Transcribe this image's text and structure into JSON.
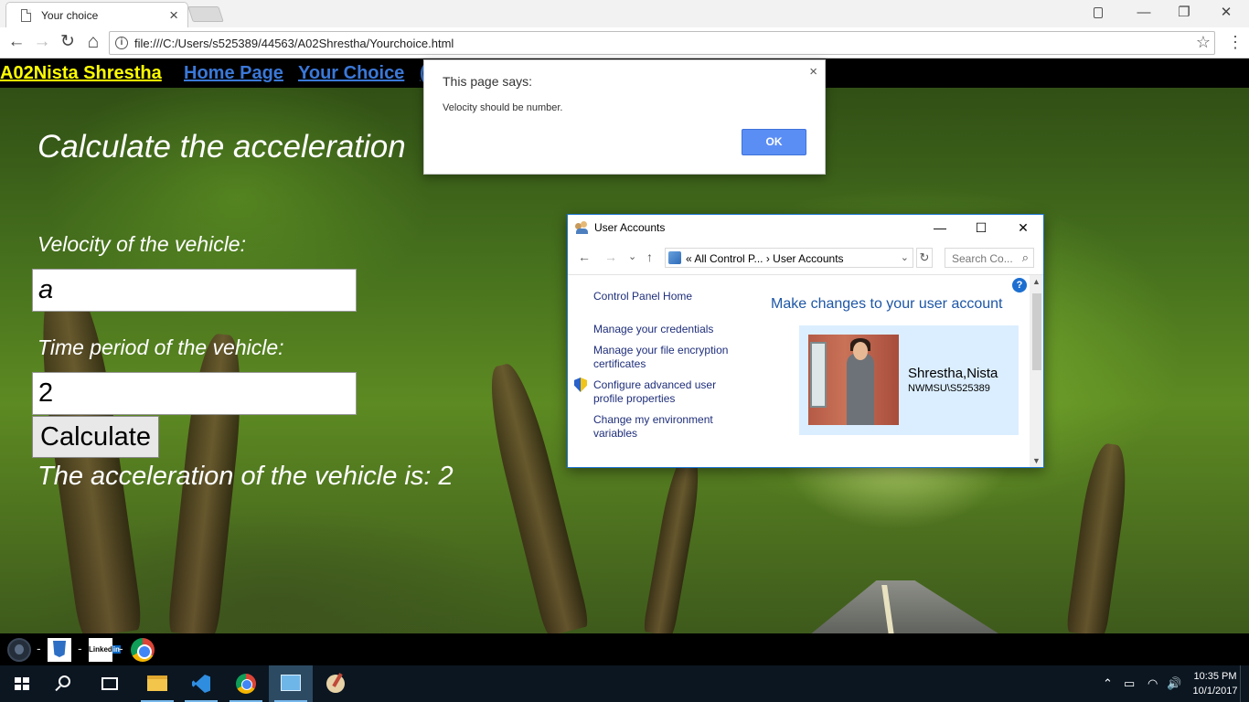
{
  "browser": {
    "tab_title": "Your choice",
    "tab_close": "×",
    "url": "file:///C:/Users/s525389/44563/A02Shrestha/Yourchoice.html",
    "back": "←",
    "forward": "→",
    "reload": "↻",
    "home": "⌂",
    "info": "i",
    "star": "☆",
    "menu": "⋮",
    "win_minimize": "—",
    "win_restore": "❐",
    "win_close": "✕"
  },
  "site_nav": {
    "brand": "A02Nista  Shrestha ",
    "home": "Home Page ",
    "your_choice": "Your Choice ",
    "partial": "("
  },
  "form": {
    "heading": "Calculate the acceleration",
    "velocity_label": "Velocity of the vehicle:",
    "velocity_value": "a",
    "time_label": "Time period of the vehicle:",
    "time_value": "2",
    "calculate_label": "Calculate",
    "result": "The acceleration of the vehicle is: 2"
  },
  "alert": {
    "title": "This page says:",
    "message": "Velocity should be number.",
    "ok_label": "OK",
    "close": "×"
  },
  "user_accounts": {
    "title": "User Accounts",
    "minimize": "—",
    "maximize": "☐",
    "close": "✕",
    "back": "←",
    "forward": "→",
    "recent": "⌄",
    "up": "↑",
    "breadcrumb": "«  All Control P...   ›   User Accounts",
    "breadcrumb_dropdown": "⌄",
    "refresh": "↻",
    "search_placeholder": "Search Co...",
    "search_icon": "⌕",
    "help": "?",
    "links": {
      "home": "Control Panel Home",
      "credentials": "Manage your credentials",
      "encryption": "Manage your file encryption certificates",
      "advanced": "Configure advanced user profile properties",
      "environment": "Change my environment variables"
    },
    "heading": "Make changes to your user account",
    "user_name": "Shrestha,Nista",
    "user_domain": "NWMSU\\S525389",
    "scroll_up": "▲",
    "scroll_down": "▼"
  },
  "social": {
    "dash": "-",
    "linkedin_text": "Linked",
    "linkedin_in": "in"
  },
  "taskbar": {
    "time": "10:35 PM",
    "date": "10/1/2017",
    "tray_chevron": "⌃",
    "battery": "▭",
    "wifi": "◠",
    "volume": "🔊"
  }
}
